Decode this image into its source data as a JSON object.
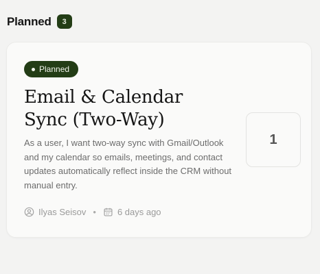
{
  "column": {
    "title": "Planned",
    "count": "3"
  },
  "card": {
    "status": "Planned",
    "title": "Email & Calendar Sync (Two-Way)",
    "description": "As a user, I want two-way sync with Gmail/Outlook and my calendar so emails, meetings, and contact updates automatically reflect inside the CRM without manual entry.",
    "votes": "1",
    "author": "Ilyas Seisov",
    "separator": "•",
    "date": "6 days ago",
    "icons": {
      "author": "user-circle-icon",
      "date": "calendar-icon"
    }
  },
  "colors": {
    "accent": "#233d16",
    "background": "#f3f3f2",
    "card": "#fafaf9"
  }
}
